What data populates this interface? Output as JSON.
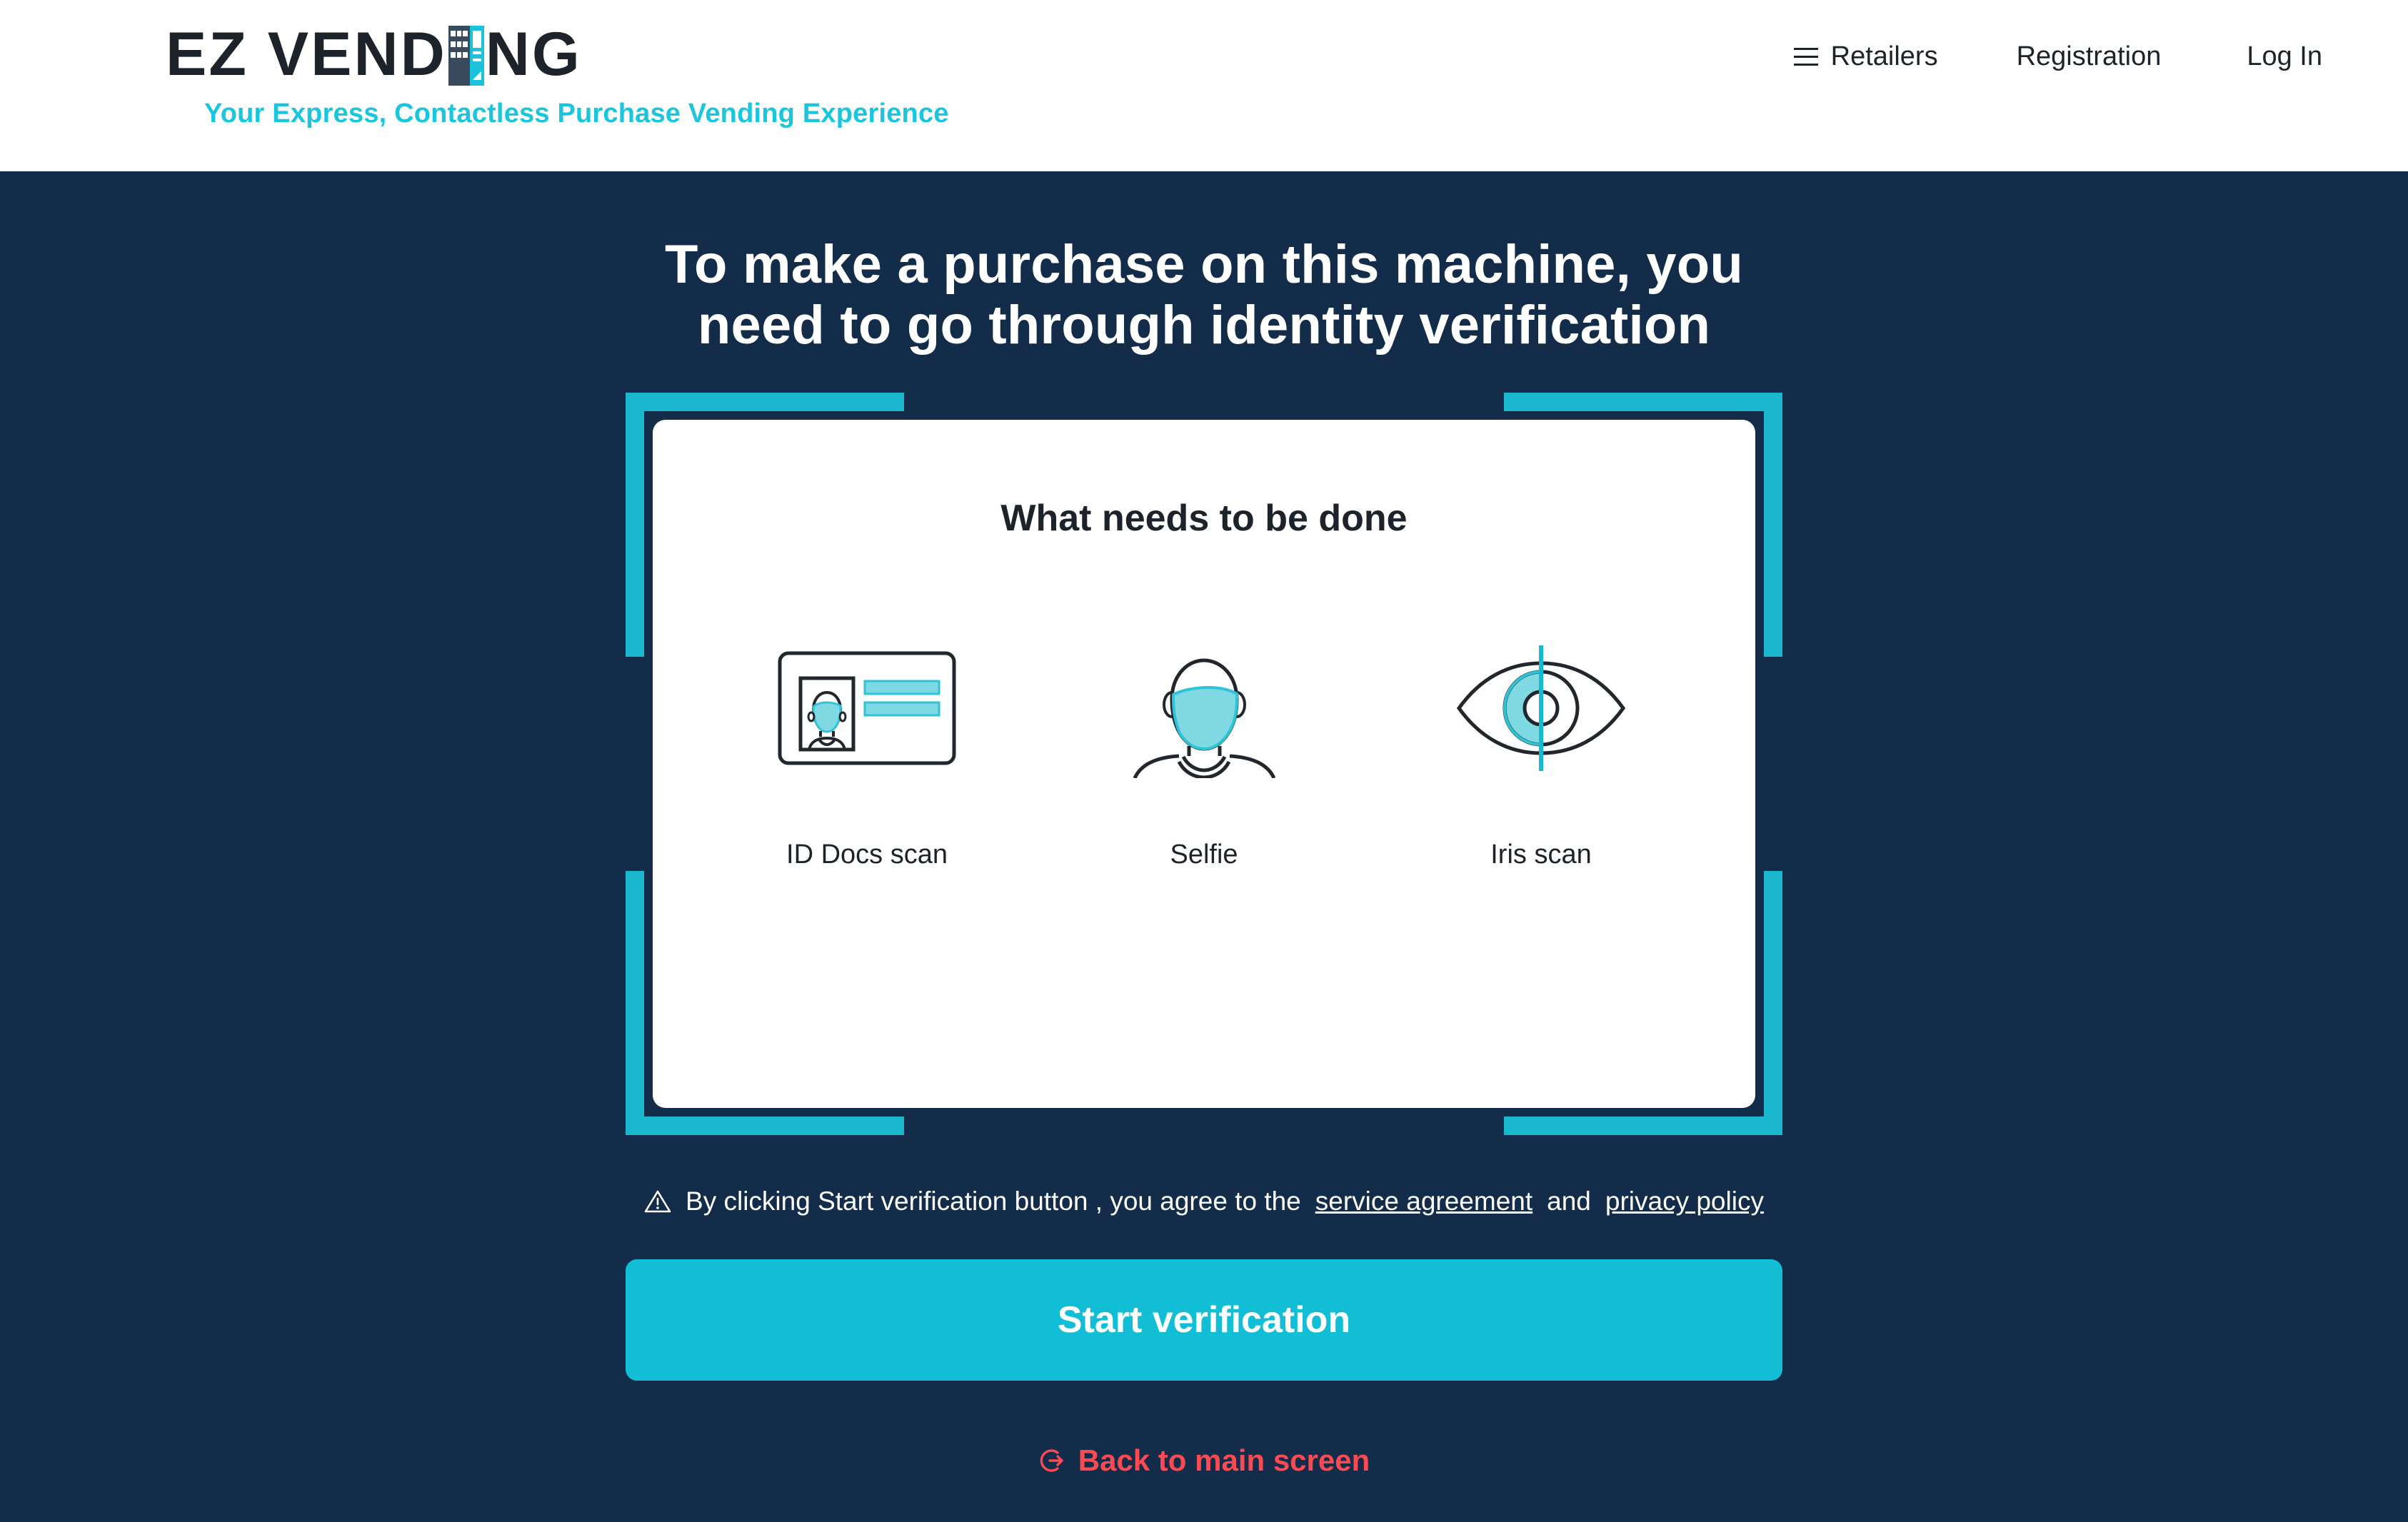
{
  "brand": {
    "logo_part1": "EZ VEND",
    "logo_part2": "NG",
    "logo_full": "EZ VENDING",
    "tagline": "Your Express, Contactless Purchase Vending Experience",
    "vending_machine_icon": "vending-machine-icon"
  },
  "nav": {
    "menu_icon": "hamburger-menu-icon",
    "items": [
      {
        "label": "Retailers",
        "icon": "hamburger-menu-icon"
      },
      {
        "label": "Registration",
        "icon": ""
      },
      {
        "label": "Log In",
        "icon": ""
      }
    ]
  },
  "main": {
    "headline": "To make a purchase on this machine, you need to go through identity verification",
    "card": {
      "title": "What needs to be done",
      "steps": [
        {
          "label": "ID Docs scan",
          "icon": "id-card-icon"
        },
        {
          "label": "Selfie",
          "icon": "face-portrait-icon"
        },
        {
          "label": "Iris scan",
          "icon": "eye-iris-scan-icon"
        }
      ]
    },
    "disclaimer": {
      "icon": "warning-triangle-icon",
      "text_before": "By clicking Start verification button , you agree to the",
      "link_service": "service agreement",
      "text_between": "and",
      "link_privacy": "privacy policy"
    },
    "cta_label": "Start verification",
    "back_link": {
      "label": "Back to main screen",
      "icon": "exit-arrow-icon"
    }
  },
  "colors": {
    "navy": "#122C4A",
    "cyan": "#12BDD6",
    "cyan_dark": "#1AB8CE",
    "cyan_light": "#7FD9E3",
    "red": "#FB4A52",
    "ink": "#1d232b",
    "white": "#ffffff"
  }
}
